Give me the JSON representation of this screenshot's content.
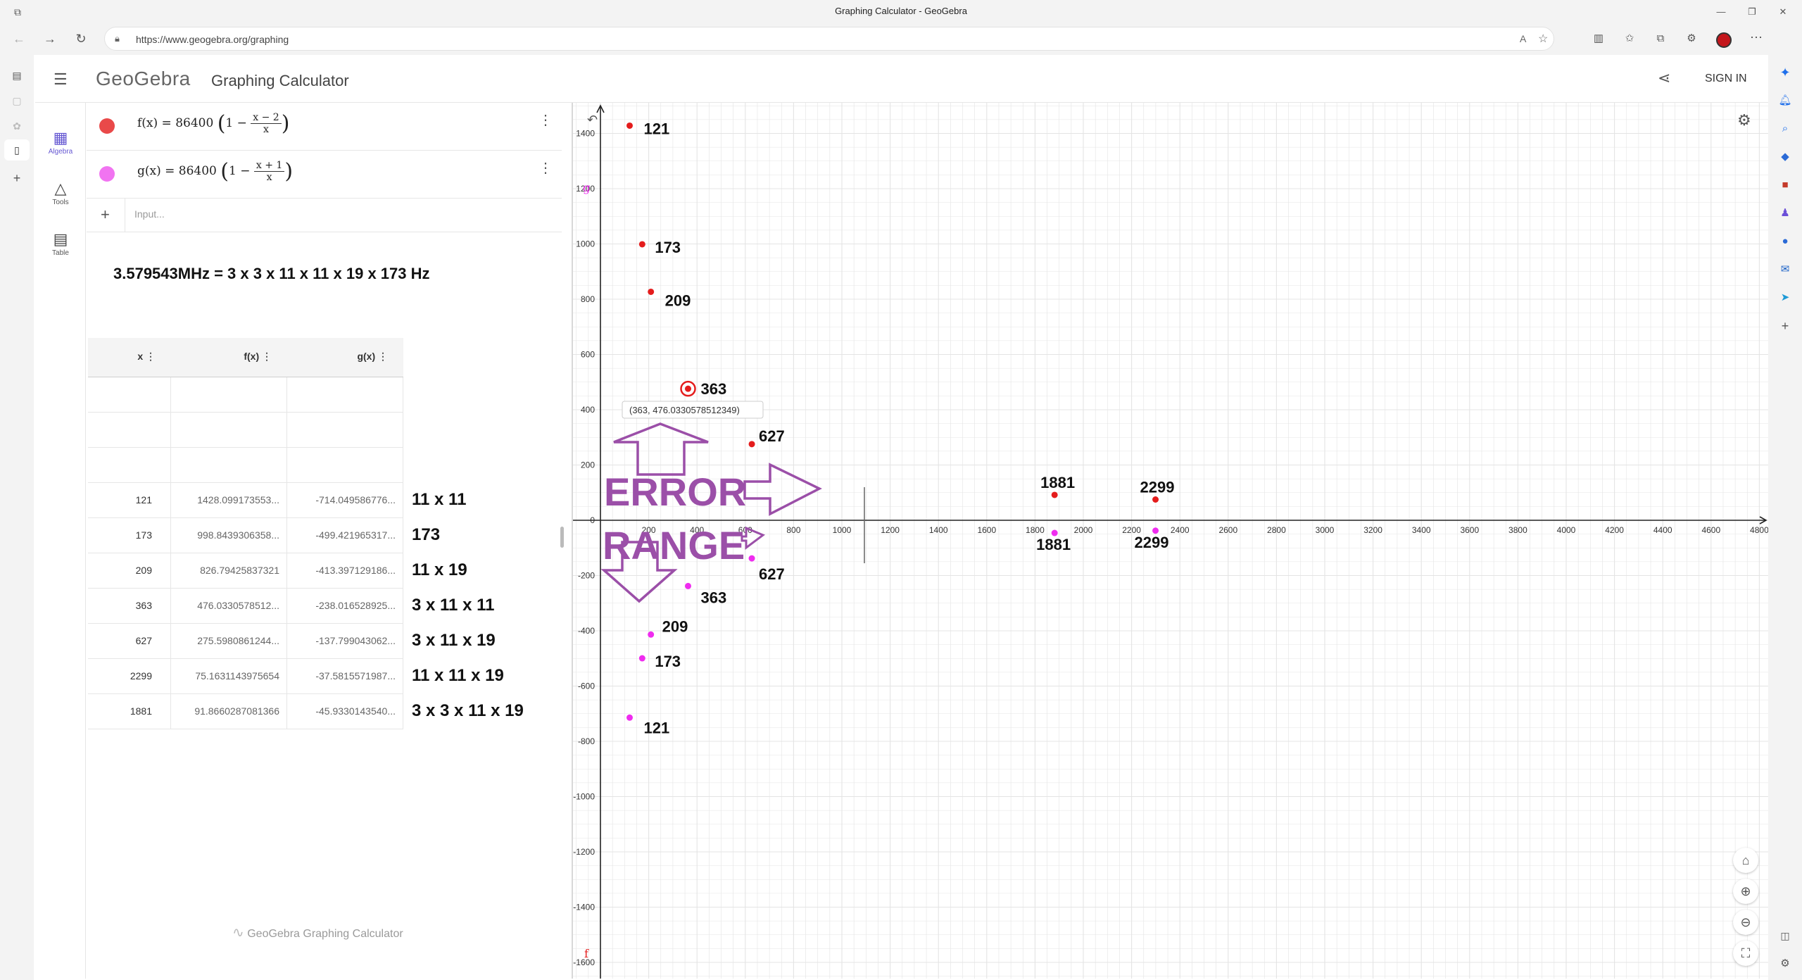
{
  "browser": {
    "window_title": "Graphing Calculator - GeoGebra",
    "url": "https://www.geogebra.org/graphing",
    "controls": {
      "minimize": "—",
      "maximize": "❐",
      "close": "✕"
    }
  },
  "app": {
    "logo": "GeoGebra",
    "title": "Graphing Calculator",
    "sign_in": "SIGN IN",
    "footer": "GeoGebra Graphing Calculator"
  },
  "sidebar": {
    "items": [
      {
        "label": "Algebra"
      },
      {
        "label": "Tools"
      },
      {
        "label": "Table"
      }
    ]
  },
  "algebra": {
    "rows": [
      {
        "name": "f",
        "color": "#e41c1c",
        "lhs": "f(x)  =  86400",
        "numerator": "x − 2",
        "denominator": "x"
      },
      {
        "name": "g",
        "color": "#ef5cef",
        "lhs": "g(x)  =  86400",
        "numerator": "x + 1",
        "denominator": "x"
      }
    ],
    "input_placeholder": "Input...",
    "add_symbol": "+",
    "note": "3.579543MHz = 3 x 3 x 11 x 11 x 19 x 173 Hz"
  },
  "table": {
    "headers": [
      "x",
      "f(x)",
      "g(x)"
    ],
    "rows": [
      {
        "x": "",
        "fx": "",
        "gx": ""
      },
      {
        "x": "",
        "fx": "",
        "gx": ""
      },
      {
        "x": "",
        "fx": "",
        "gx": ""
      },
      {
        "x": "121",
        "fx": "1428.099173553...",
        "gx": "-714.049586776...",
        "note": "11 x 11"
      },
      {
        "x": "173",
        "fx": "998.8439306358...",
        "gx": "-499.421965317...",
        "note": "173"
      },
      {
        "x": "209",
        "fx": "826.79425837321",
        "gx": "-413.397129186...",
        "note": "11 x 19"
      },
      {
        "x": "363",
        "fx": "476.0330578512...",
        "gx": "-238.016528925...",
        "note": "3 x 11 x 11"
      },
      {
        "x": "627",
        "fx": "275.5980861244...",
        "gx": "-137.799043062...",
        "note": "3 x 11 x 19"
      },
      {
        "x": "2299",
        "fx": "75.1631143975654",
        "gx": "-37.5815571987...",
        "note": "11 x 11 x 19"
      },
      {
        "x": "1881",
        "fx": "91.8660287081366",
        "gx": "-45.9330143540...",
        "note": "3 x 3 x 11 x 19"
      }
    ]
  },
  "graph": {
    "x_ticks": [
      200,
      400,
      600,
      800,
      1000,
      1200,
      1400,
      1600,
      1800,
      2000,
      2200,
      2400,
      2600,
      2800,
      3000,
      3200,
      3400,
      3600,
      3800,
      4000,
      4200,
      4400,
      4600,
      4800
    ],
    "y_ticks": [
      -1600,
      -1400,
      -1200,
      -1000,
      -800,
      -600,
      -400,
      -200,
      0,
      200,
      400,
      600,
      800,
      1000,
      1200,
      1400
    ],
    "f_points": [
      121,
      173,
      209,
      363,
      627,
      1881,
      2299
    ],
    "g_points": [
      121,
      173,
      209,
      363,
      627,
      1881,
      2299
    ],
    "tooltip": "(363, 476.0330578512349)",
    "f_label": "f",
    "g_label": "g",
    "annotations": {
      "error": "ERROR",
      "range": "RANGE"
    },
    "colors": {
      "f": "#e41c1c",
      "g": "#ef2cef",
      "annot": "#9b4fa8",
      "grid": "#e4e4e4",
      "gridMajor": "#d0d0d0"
    }
  }
}
